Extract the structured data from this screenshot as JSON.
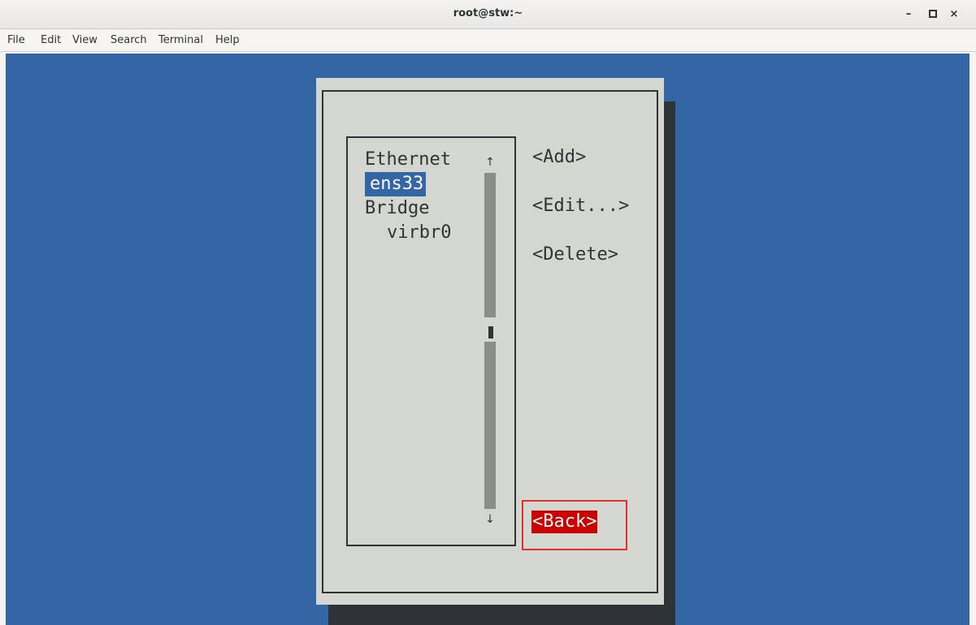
{
  "window": {
    "title": "root@stw:~",
    "controls": {
      "minimize": "–",
      "close": "×"
    }
  },
  "menu": {
    "items": [
      "File",
      "Edit",
      "View",
      "Search",
      "Terminal",
      "Help"
    ]
  },
  "dialog": {
    "list": {
      "rows": [
        "Ethernet",
        "ens33",
        "Bridge",
        "virbr0"
      ],
      "selected": "ens33",
      "scroll_up": "↑",
      "scroll_down": "↓"
    },
    "buttons": {
      "add": "<Add>",
      "edit": "<Edit...>",
      "delete": "<Delete>",
      "back": "<Back>"
    },
    "focused_button": "back"
  },
  "colors": {
    "terminal_bg": "#3465a4",
    "dialog_bg": "#d3d7cf",
    "selection_bg": "#3465a4",
    "focus_bg": "#cc0000",
    "annotation_box": "#e03030"
  }
}
